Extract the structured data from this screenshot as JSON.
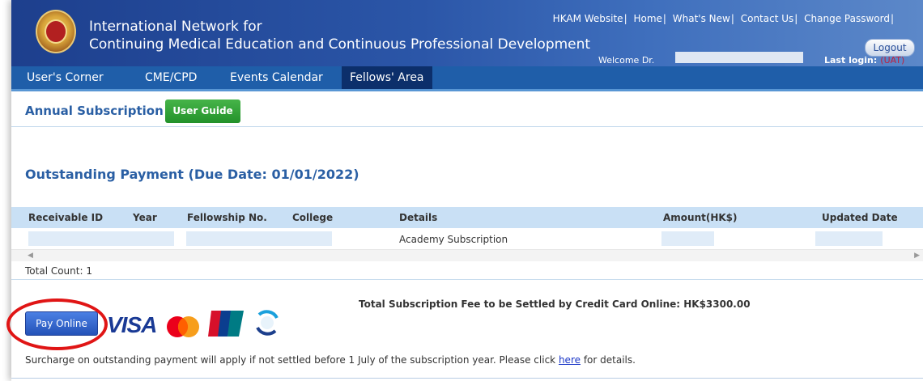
{
  "header": {
    "title_line1": "International Network for",
    "title_line2": "Continuing Medical Education and Continuous Professional Development",
    "top_links": [
      "HKAM Website",
      "Home",
      "What's New",
      "Contact Us",
      "Change Password"
    ],
    "logout_label": "Logout",
    "welcome_label": "Welcome Dr.",
    "last_login_label": "Last login:",
    "env_badge": "(UAT)"
  },
  "nav": {
    "items": [
      {
        "label": "User's Corner"
      },
      {
        "label": "CME/CPD"
      },
      {
        "label": "Events Calendar"
      },
      {
        "label": "Fellows' Area",
        "active": true
      }
    ]
  },
  "page": {
    "heading": "Annual Subscription",
    "user_guide_label": "User Guide",
    "outstanding_heading": "Outstanding Payment (Due Date: 01/01/2022)"
  },
  "table": {
    "columns": [
      "Receivable ID",
      "Year",
      "Fellowship No.",
      "College",
      "Details",
      "Amount(HK$)",
      "Updated Date"
    ],
    "rows": [
      {
        "receivable_id": "",
        "year": "",
        "fellowship_no": "",
        "college": "",
        "details": "Academy Subscription",
        "amount": "",
        "updated_date": ""
      }
    ],
    "total_count": "Total Count: 1"
  },
  "payment": {
    "total_fee_text": "Total Subscription Fee to be Settled by Credit Card Online:  HK$3300.00",
    "pay_online_label": "Pay Online",
    "card_logos": [
      "visa-logo",
      "mastercard-logo",
      "unionpay-logo",
      "fps-logo"
    ],
    "visa_text": "VISA",
    "surcharge_text": "Surcharge on outstanding payment will apply if not settled before 1 July of the subscription year. Please click",
    "surcharge_link": "here",
    "surcharge_suffix": "for details."
  },
  "colors": {
    "header_blue": "#1d3f8d",
    "nav_blue": "#1f5ea9",
    "heading_blue": "#2a5fa4",
    "user_guide_green": "#2b9a30",
    "pay_button_blue": "#2452b8",
    "highlight_red": "#e01515"
  }
}
